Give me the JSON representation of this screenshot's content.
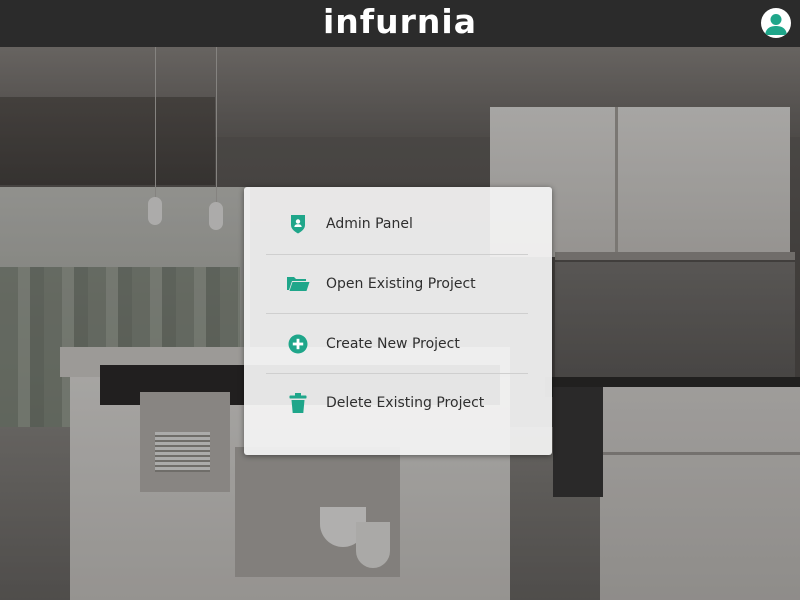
{
  "header": {
    "logo_text": "infurnia",
    "profile_icon": "user-avatar-icon"
  },
  "menu": {
    "items": [
      {
        "label": "Admin Panel",
        "icon": "admin-shield-icon"
      },
      {
        "label": "Open Existing Project",
        "icon": "folder-open-icon"
      },
      {
        "label": "Create New Project",
        "icon": "plus-circle-icon"
      },
      {
        "label": "Delete Existing Project",
        "icon": "trash-icon"
      }
    ]
  },
  "colors": {
    "accent": "#1fa68a",
    "topbar": "#2b2b2b",
    "panel": "#f4f4f4"
  }
}
